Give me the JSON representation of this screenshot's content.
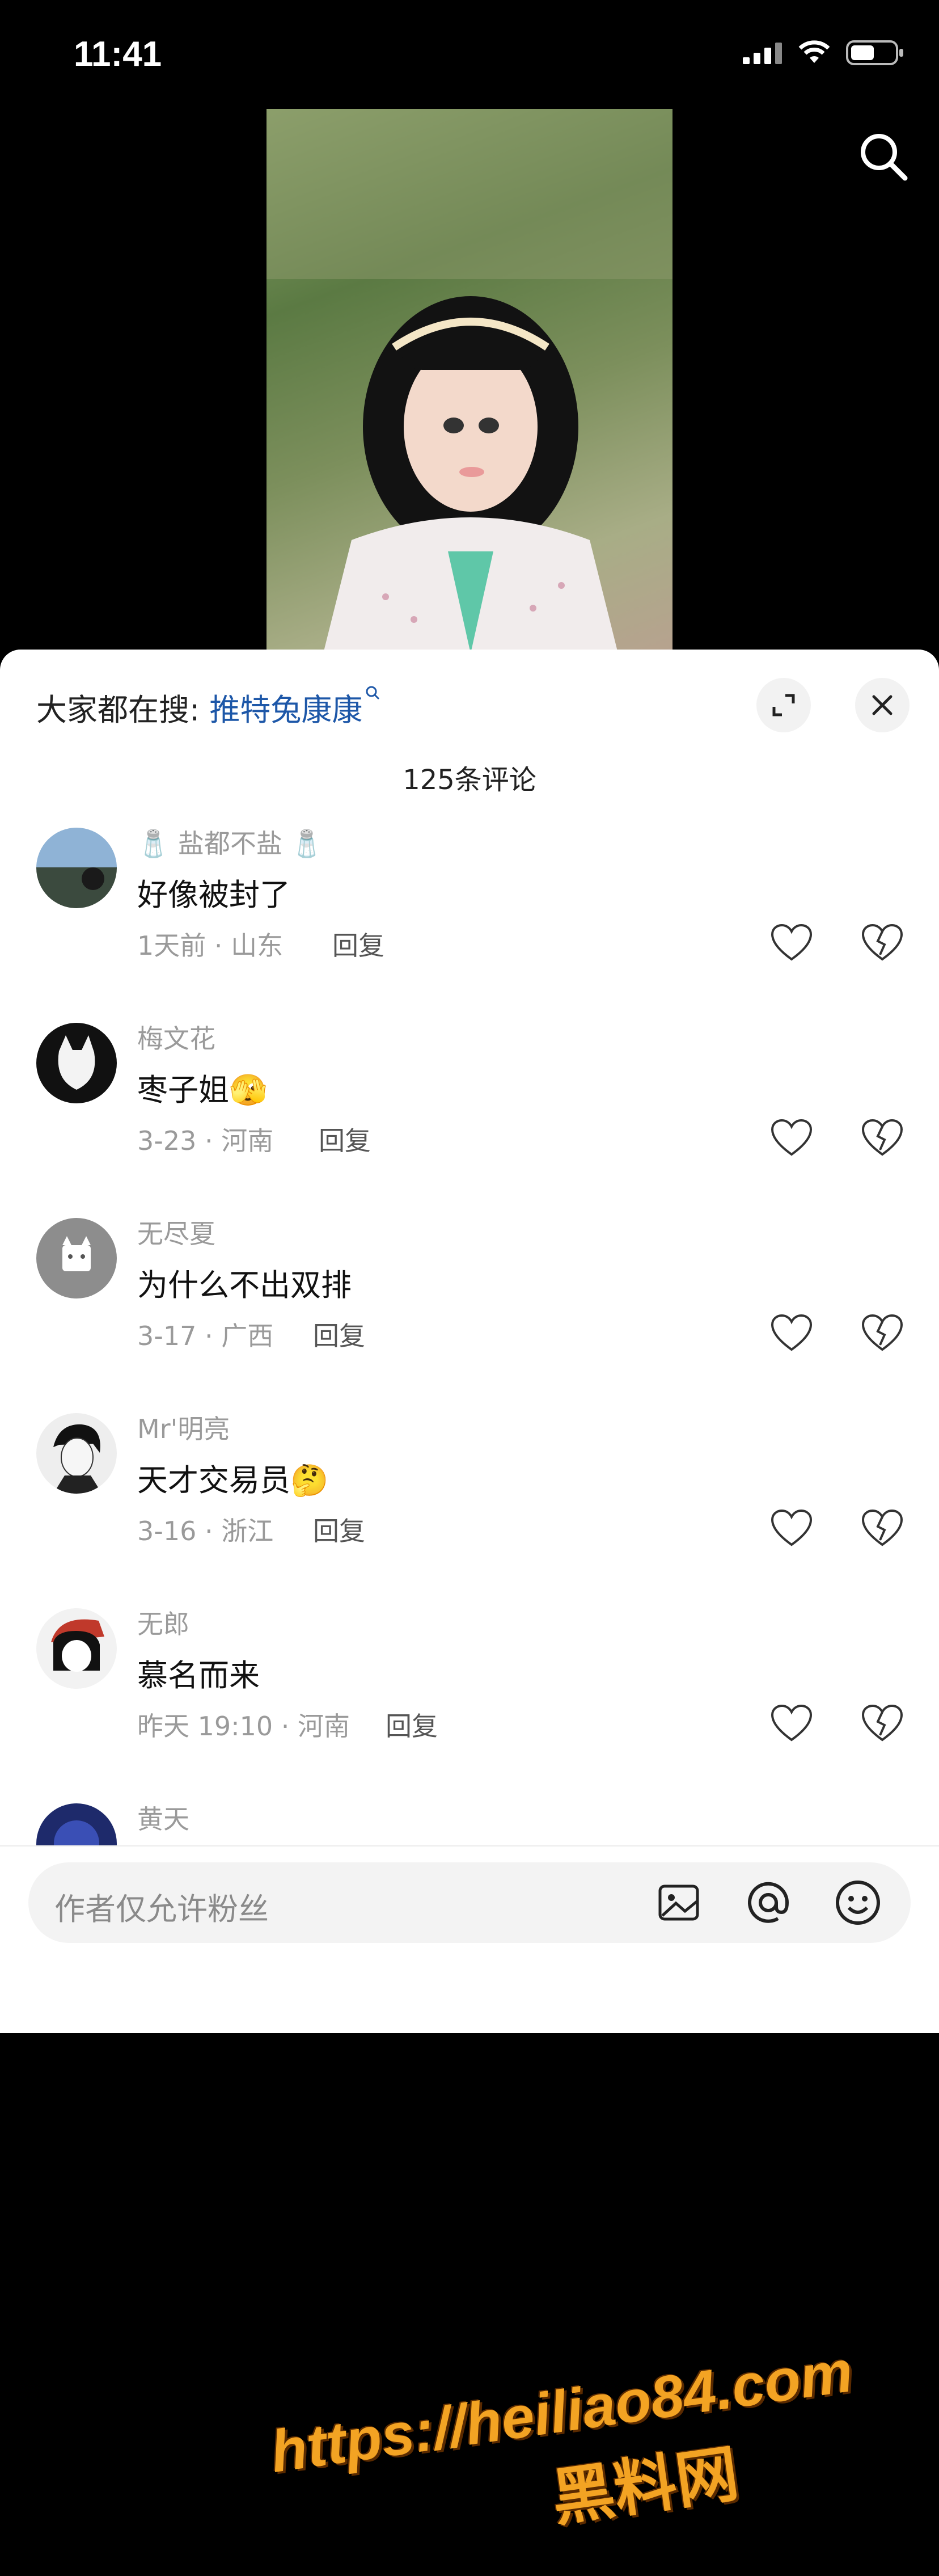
{
  "status_bar": {
    "time": "11:41"
  },
  "panel": {
    "search_hint_prefix": "大家都在搜: ",
    "search_hint_term": "推特兔康康",
    "comment_count": "125条评论"
  },
  "comments": [
    {
      "name": "🧂 盐都不盐 🧂",
      "text": "好像被封了",
      "meta": "1天前 · 山东",
      "reply": "回复"
    },
    {
      "name": "梅文花",
      "text": "枣子姐",
      "emoji": "🫣",
      "meta": "3-23 · 河南",
      "reply": "回复"
    },
    {
      "name": "无尽夏",
      "text": "为什么不出双排",
      "meta": "3-17 · 广西",
      "reply": "回复"
    },
    {
      "name": "Mr'明亮",
      "text": "天才交易员",
      "emoji": "🤔",
      "meta": "3-16 · 浙江",
      "reply": "回复"
    },
    {
      "name": "无郎",
      "text": "慕名而来",
      "meta": "昨天 19:10 · 河南",
      "reply": "回复"
    },
    {
      "name": "黄天"
    }
  ],
  "input": {
    "placeholder": "作者仅允许粉丝"
  },
  "watermark": {
    "url": "https://heiliao84.com",
    "site": "黑料网"
  },
  "colors": {
    "accent_link": "#1d57a8",
    "watermark": "#f3a323"
  }
}
